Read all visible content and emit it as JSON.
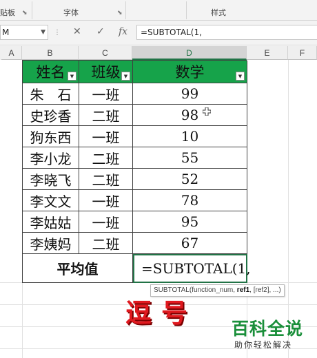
{
  "ribbon": {
    "group_clipboard": "贴板",
    "group_font": "字体",
    "group_styles": "样式"
  },
  "formula_bar": {
    "name_box": "M",
    "cancel_icon": "✕",
    "enter_icon": "✓",
    "fx_label": "fx",
    "formula": "=SUBTOTAL(1,"
  },
  "columns": [
    "A",
    "B",
    "C",
    "D",
    "E",
    "F"
  ],
  "table": {
    "headers": [
      "姓名",
      "班级",
      "数学"
    ],
    "rows": [
      {
        "name": "朱　石",
        "class": "一班",
        "math": "99"
      },
      {
        "name": "史珍香",
        "class": "二班",
        "math": "98"
      },
      {
        "name": "狗东西",
        "class": "一班",
        "math": "10"
      },
      {
        "name": "李小龙",
        "class": "二班",
        "math": "55"
      },
      {
        "name": "李晓飞",
        "class": "二班",
        "math": "52"
      },
      {
        "name": "李文文",
        "class": "一班",
        "math": "78"
      },
      {
        "name": "李姑姑",
        "class": "一班",
        "math": "95"
      },
      {
        "name": "李姨妈",
        "class": "二班",
        "math": "67"
      }
    ],
    "avg_label": "平均值",
    "avg_formula": "=SUBTOTAL(1,"
  },
  "tooltip": {
    "fn": "SUBTOTAL(function_num, ",
    "bold_arg": "ref1",
    "rest": ", [ref2], ...)"
  },
  "overlay": "逗号",
  "watermark": {
    "title": "百科全说",
    "subtitle": "助你轻松解决"
  },
  "colors": {
    "header_fill": "#16a34a",
    "selection": "#217346",
    "overlay_red": "#e0191f",
    "watermark_green": "#1a8f3a"
  }
}
